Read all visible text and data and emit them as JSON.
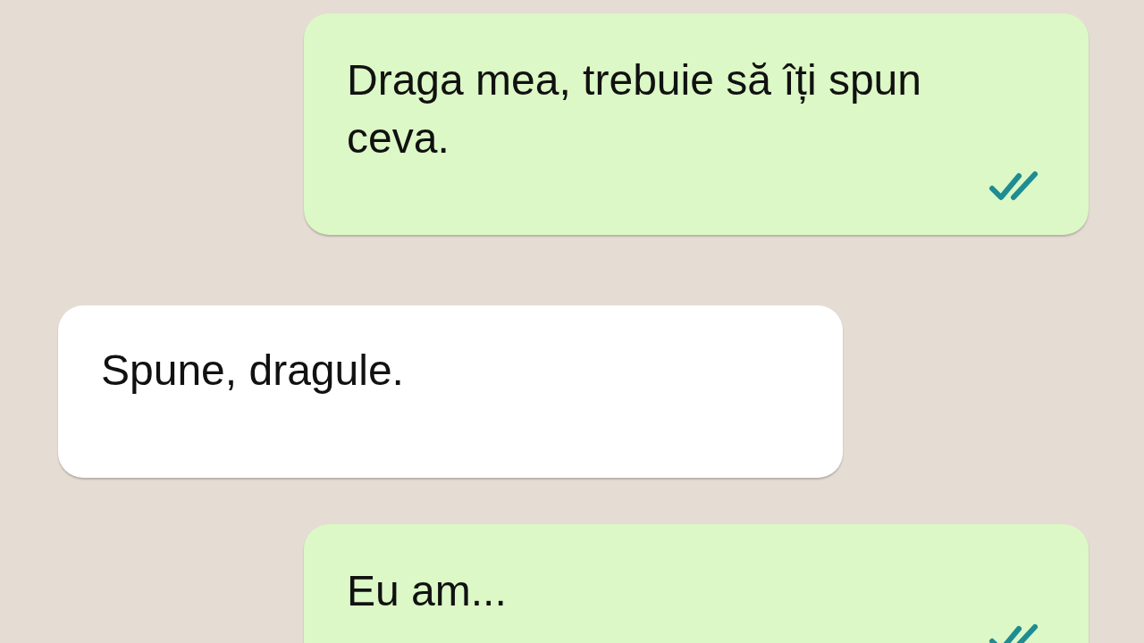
{
  "messages": [
    {
      "kind": "sent",
      "text": "Draga mea, trebuie să îți spun ceva.",
      "read": true
    },
    {
      "kind": "received",
      "text": "Spune, dragule."
    },
    {
      "kind": "sent",
      "text": "Eu am...",
      "read": true
    }
  ]
}
